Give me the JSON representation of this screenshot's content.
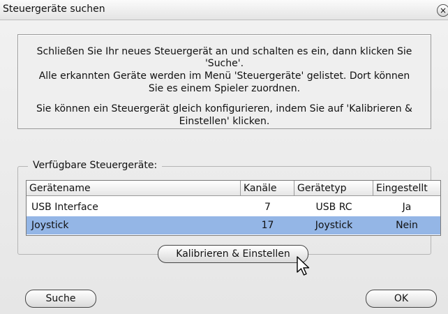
{
  "window": {
    "title": "Steuergeräte suchen",
    "close_symbol": "×"
  },
  "info": {
    "line1": "Schließen Sie Ihr neues Steuergerät an und schalten es ein, dann klicken Sie",
    "line2": "'Suche'.",
    "line3": "Alle erkannten Geräte werden im Menü 'Steuergeräte' gelistet. Dort können",
    "line4": "Sie es einem Spieler zuordnen.",
    "line5": "Sie können ein Steuergerät gleich konfigurieren, indem Sie auf 'Kalibrieren &",
    "line6": "Einstellen' klicken."
  },
  "devices": {
    "legend": "Verfügbare Steuergeräte:",
    "columns": [
      "Gerätename",
      "Kanäle",
      "Gerätetyp",
      "Eingestellt"
    ],
    "rows": [
      {
        "name": "USB Interface",
        "channels": "7",
        "type": "USB RC",
        "configured": "Ja"
      },
      {
        "name": "Joystick",
        "channels": "17",
        "type": "Joystick",
        "configured": "Nein"
      }
    ],
    "selected_row": 1,
    "selection_color": "#94b6e6"
  },
  "buttons": {
    "calibrate": "Kalibrieren & Einstellen",
    "search": "Suche",
    "ok": "OK"
  },
  "icons": {
    "close": "close-icon",
    "cursor": "mouse-pointer-icon"
  }
}
